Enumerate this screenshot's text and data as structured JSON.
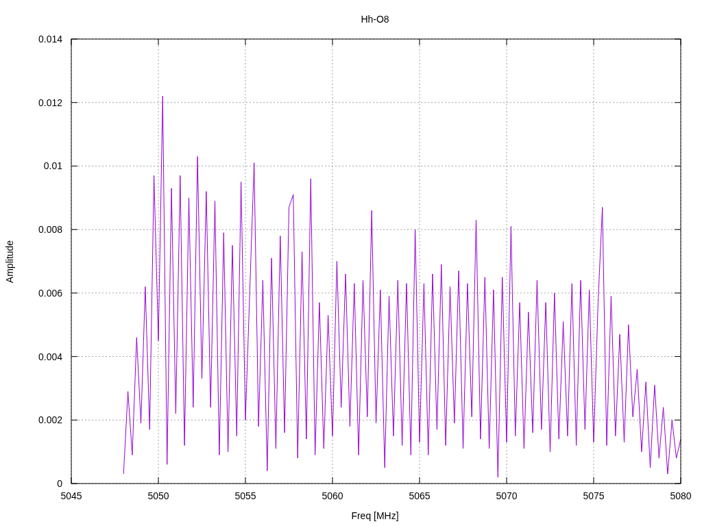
{
  "chart_data": {
    "type": "line",
    "title": "Hh-O8",
    "xlabel": "Freq [MHz]",
    "ylabel": "Amplitude",
    "grid": true,
    "xlim": [
      5045,
      5080
    ],
    "ylim": [
      0,
      0.014
    ],
    "xticks": [
      5045,
      5050,
      5055,
      5060,
      5065,
      5070,
      5075,
      5080
    ],
    "yticks": [
      0,
      0.002,
      0.004,
      0.006,
      0.008,
      0.01,
      0.012,
      0.014
    ],
    "x": [
      5048,
      5048.25,
      5048.5,
      5048.75,
      5049,
      5049.25,
      5049.5,
      5049.75,
      5050,
      5050.25,
      5050.5,
      5050.75,
      5051,
      5051.25,
      5051.5,
      5051.75,
      5052,
      5052.25,
      5052.5,
      5052.75,
      5053,
      5053.25,
      5053.5,
      5053.75,
      5054,
      5054.25,
      5054.5,
      5054.75,
      5055,
      5055.25,
      5055.5,
      5055.75,
      5056,
      5056.25,
      5056.5,
      5056.75,
      5057,
      5057.25,
      5057.5,
      5057.75,
      5058,
      5058.25,
      5058.5,
      5058.75,
      5059,
      5059.25,
      5059.5,
      5059.75,
      5060,
      5060.25,
      5060.5,
      5060.75,
      5061,
      5061.25,
      5061.5,
      5061.75,
      5062,
      5062.25,
      5062.5,
      5062.75,
      5063,
      5063.25,
      5063.5,
      5063.75,
      5064,
      5064.25,
      5064.5,
      5064.75,
      5065,
      5065.25,
      5065.5,
      5065.75,
      5066,
      5066.25,
      5066.5,
      5066.75,
      5067,
      5067.25,
      5067.5,
      5067.75,
      5068,
      5068.25,
      5068.5,
      5068.75,
      5069,
      5069.25,
      5069.5,
      5069.75,
      5070,
      5070.25,
      5070.5,
      5070.75,
      5071,
      5071.25,
      5071.5,
      5071.75,
      5072,
      5072.25,
      5072.5,
      5072.75,
      5073,
      5073.25,
      5073.5,
      5073.75,
      5074,
      5074.25,
      5074.5,
      5074.75,
      5075,
      5075.25,
      5075.5,
      5075.75,
      5076,
      5076.25,
      5076.5,
      5076.75,
      5077,
      5077.25,
      5077.5,
      5077.75,
      5078,
      5078.25,
      5078.5,
      5078.75,
      5079,
      5079.25,
      5079.5,
      5079.75,
      5080
    ],
    "series": [
      {
        "color": "#9400d3",
        "values": [
          0.0003,
          0.0029,
          0.0009,
          0.0046,
          0.0019,
          0.0062,
          0.0017,
          0.0097,
          0.0045,
          0.0122,
          0.0006,
          0.0093,
          0.0022,
          0.0097,
          0.0012,
          0.009,
          0.0024,
          0.0103,
          0.0033,
          0.0092,
          0.0024,
          0.0089,
          0.0009,
          0.0079,
          0.001,
          0.0075,
          0.0015,
          0.0095,
          0.002,
          0.0061,
          0.0101,
          0.0018,
          0.0064,
          0.0004,
          0.0071,
          0.0011,
          0.0078,
          0.0016,
          0.0087,
          0.0091,
          0.0008,
          0.0073,
          0.0014,
          0.0096,
          0.0009,
          0.0057,
          0.0011,
          0.0053,
          0.0015,
          0.007,
          0.0024,
          0.0066,
          0.0018,
          0.0063,
          0.0009,
          0.0064,
          0.0021,
          0.0086,
          0.0019,
          0.0061,
          0.0005,
          0.0059,
          0.0015,
          0.0064,
          0.0012,
          0.0063,
          0.0009,
          0.008,
          0.0013,
          0.0063,
          0.0009,
          0.0066,
          0.0017,
          0.0069,
          0.0012,
          0.0062,
          0.0019,
          0.0067,
          0.0011,
          0.0063,
          0.0021,
          0.0083,
          0.0014,
          0.0065,
          0.0011,
          0.0061,
          0.0002,
          0.0065,
          0.0013,
          0.0081,
          0.0015,
          0.0057,
          0.0011,
          0.0054,
          0.0016,
          0.0064,
          0.0017,
          0.0057,
          0.001,
          0.006,
          0.0014,
          0.0051,
          0.0015,
          0.0063,
          0.0012,
          0.0064,
          0.0017,
          0.0061,
          0.0013,
          0.0057,
          0.0087,
          0.0012,
          0.0059,
          0.0015,
          0.0047,
          0.0013,
          0.005,
          0.0021,
          0.0036,
          0.001,
          0.0032,
          0.0005,
          0.0031,
          0.0008,
          0.0024,
          0.0003,
          0.002,
          0.0008,
          0.0014
        ]
      }
    ]
  }
}
